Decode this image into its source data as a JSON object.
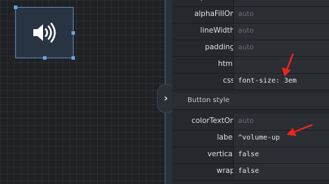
{
  "canvas": {
    "widget_icon": "volume-up-icon"
  },
  "properties": {
    "rows_top": [
      {
        "name": "alphaFillOff",
        "value": "auto",
        "muted": true
      },
      {
        "name": "alphaFillOn",
        "value": "auto",
        "muted": true
      },
      {
        "name": "lineWidth",
        "value": "auto",
        "muted": true
      },
      {
        "name": "padding",
        "value": "auto",
        "muted": true
      },
      {
        "name": "html",
        "value": "",
        "muted": false
      },
      {
        "name": "css",
        "value": "font-size: 3em",
        "muted": false
      }
    ],
    "section_title": "Button style",
    "rows_bottom": [
      {
        "name": "colorTextOn",
        "value": "auto",
        "muted": true
      },
      {
        "name": "label",
        "value": "^volume-up",
        "muted": false
      },
      {
        "name": "vertical",
        "value": "false",
        "muted": false
      },
      {
        "name": "wrap",
        "value": "false",
        "muted": false
      }
    ]
  },
  "colors": {
    "annotation_arrow": "#e8261e",
    "selection": "#5f8fc4"
  }
}
